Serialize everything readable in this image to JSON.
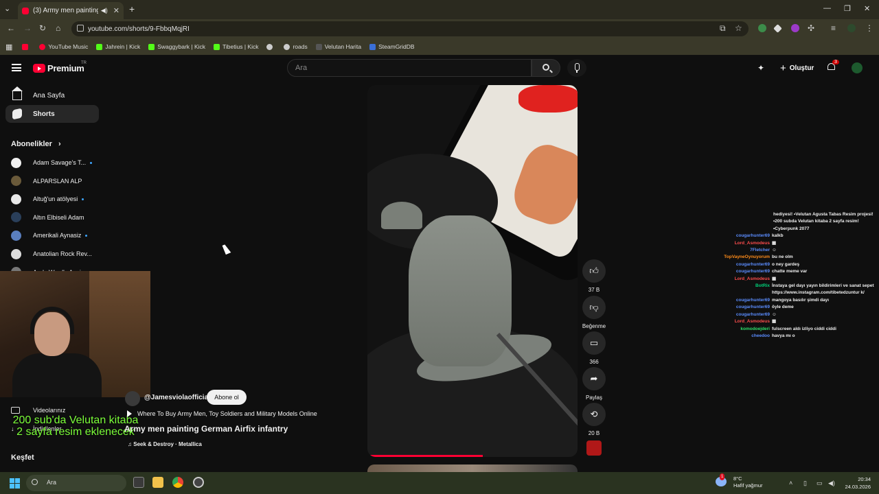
{
  "browser": {
    "tab_title": "(3) Army men painting Ger",
    "url": "youtube.com/shorts/9-FbbqMqjRI",
    "bookmarks": [
      "YouTube Music",
      "Jahrein | Kick",
      "Swaggybark | Kick",
      "Tibetius | Kick",
      "roads",
      "Velutan Harita",
      "SteamGridDB"
    ]
  },
  "youtube": {
    "logo": "Premium",
    "logo_country": "TR",
    "search_placeholder": "Ara",
    "create_label": "Oluştur",
    "notifications": "3"
  },
  "sidebar": {
    "home": "Ana Sayfa",
    "shorts": "Shorts",
    "subscriptions_header": "Abonelikler",
    "subscriptions": [
      {
        "name": "Adam Savage's T...",
        "color": "#f0f0f0",
        "new": true
      },
      {
        "name": "ALPARSLAN ALP",
        "color": "#6a5a3a",
        "new": false
      },
      {
        "name": "Altuğ'un atölyesi",
        "color": "#e8e8e8",
        "new": true
      },
      {
        "name": "Altın Elbiseli Adam",
        "color": "#2a3f5a",
        "new": false
      },
      {
        "name": "Amerikali Aynasiz",
        "color": "#5a7fbf",
        "new": true
      },
      {
        "name": "Anatolian Rock Rev...",
        "color": "#dddddd",
        "new": false
      },
      {
        "name": "Andy Ward's Ancien",
        "color": "#777777",
        "new": false
      }
    ],
    "your_videos": "Videolarınız",
    "downloads": "İndirilenler",
    "explore": "Keşfet"
  },
  "stream_overlay": {
    "line1": "200 sub'da Velutan kitaba",
    "line2": "2 sayfa resim eklenecek"
  },
  "short": {
    "channel": "@Jamesviolaofficial",
    "subscribe": "Abone ol",
    "link_text": "Where To Buy Army Men, Toy Soldiers and Military Models Online",
    "title": "Army men painting German Airfix infantry",
    "music": "Seek & Destroy · Metallica",
    "progress": 0.55
  },
  "actions": {
    "likes": "37 B",
    "dislike_label": "Beğenme",
    "comments": "366",
    "share_label": "Paylaş",
    "remix_count": "20 B"
  },
  "chat": {
    "header_message": "hediyesi! •Velutan Agusta Tabas Resim projesi! •200 subda Velutan kitaba 2 sayfa resim! •Cyberpunk 2077",
    "lines": [
      {
        "nick": "cougarhunter69",
        "color": "#5b8dff",
        "msg": "kalkb"
      },
      {
        "nick": "Lord_Asmodeus",
        "color": "#ff4d4d",
        "msg": "▦"
      },
      {
        "nick": "7Fletcher",
        "color": "#5b8dff",
        "msg": "☺"
      },
      {
        "nick": "TopVayneOynuyorum",
        "color": "#ff8c1a",
        "msg": "bu ne olm"
      },
      {
        "nick": "cougarhunter69",
        "color": "#5b8dff",
        "msg": "o ney gardeş"
      },
      {
        "nick": "cougarhunter69",
        "color": "#5b8dff",
        "msg": "chatte meme var"
      },
      {
        "nick": "Lord_Asmodeus",
        "color": "#ff4d4d",
        "msg": "▦"
      },
      {
        "nick": "BotRix",
        "color": "#00d27a",
        "msg": "İnstaya gel dayı yayın bildirimleri ve sanat sepet https://www.instagram.com/tibetedzuntur k/"
      },
      {
        "nick": "cougarhunter69",
        "color": "#5b8dff",
        "msg": "mangoya basılır şimdi dayı"
      },
      {
        "nick": "cougarhunter69",
        "color": "#5b8dff",
        "msg": "öyle deme"
      },
      {
        "nick": "cougarhunter69",
        "color": "#5b8dff",
        "msg": "☺"
      },
      {
        "nick": "Lord_Asmodeus",
        "color": "#ff4d4d",
        "msg": "▦"
      },
      {
        "nick": "komodoejderi",
        "color": "#2ee06a",
        "msg": "fulscreen aldı izliyo ciddi ciddi"
      },
      {
        "nick": "cheedoo",
        "color": "#5b8dff",
        "msg": "havya mı o"
      }
    ]
  },
  "taskbar": {
    "search": "Ara",
    "weather_temp": "8°C",
    "weather_desc": "Hafif yağmur",
    "weather_alerts": "1",
    "time": "20:34",
    "date": "24.03.2026"
  }
}
